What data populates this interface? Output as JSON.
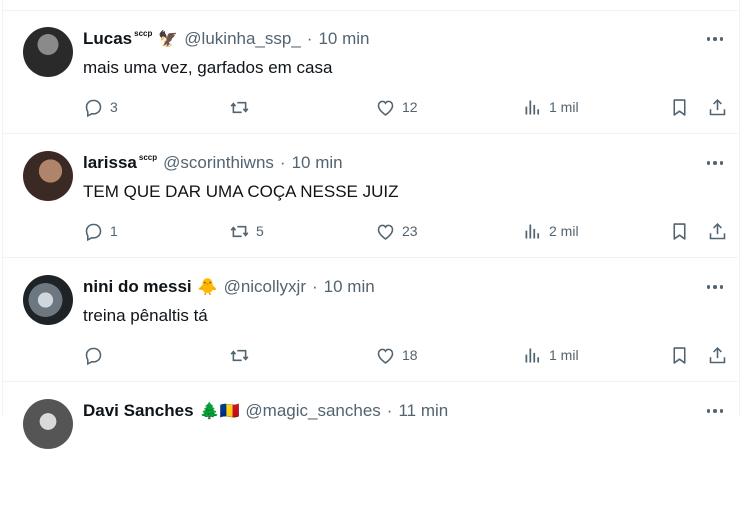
{
  "tweets": [
    {
      "name": "Lucas",
      "badge": "sccp",
      "emoji": "🦅",
      "handle": "@lukinha_ssp_",
      "time": "10 min",
      "text": "mais uma vez, garfados em casa",
      "replies": "3",
      "retweets": "",
      "likes": "12",
      "views": "1 mil"
    },
    {
      "name": "larissa",
      "badge": "sccp",
      "emoji": "",
      "handle": "@scorinthiwns",
      "time": "10 min",
      "text": "TEM QUE DAR UMA COÇA NESSE JUIZ",
      "replies": "1",
      "retweets": "5",
      "likes": "23",
      "views": "2 mil"
    },
    {
      "name": "nini do messi",
      "badge": "",
      "emoji": "🐥",
      "handle": "@nicollyxjr",
      "time": "10 min",
      "text": "treina pênaltis tá",
      "replies": "",
      "retweets": "",
      "likes": "18",
      "views": "1 mil"
    },
    {
      "name": "Davi Sanches",
      "badge": "",
      "emoji": "🌲🇷🇴",
      "handle": "@magic_sanches",
      "time": "11 min"
    }
  ]
}
